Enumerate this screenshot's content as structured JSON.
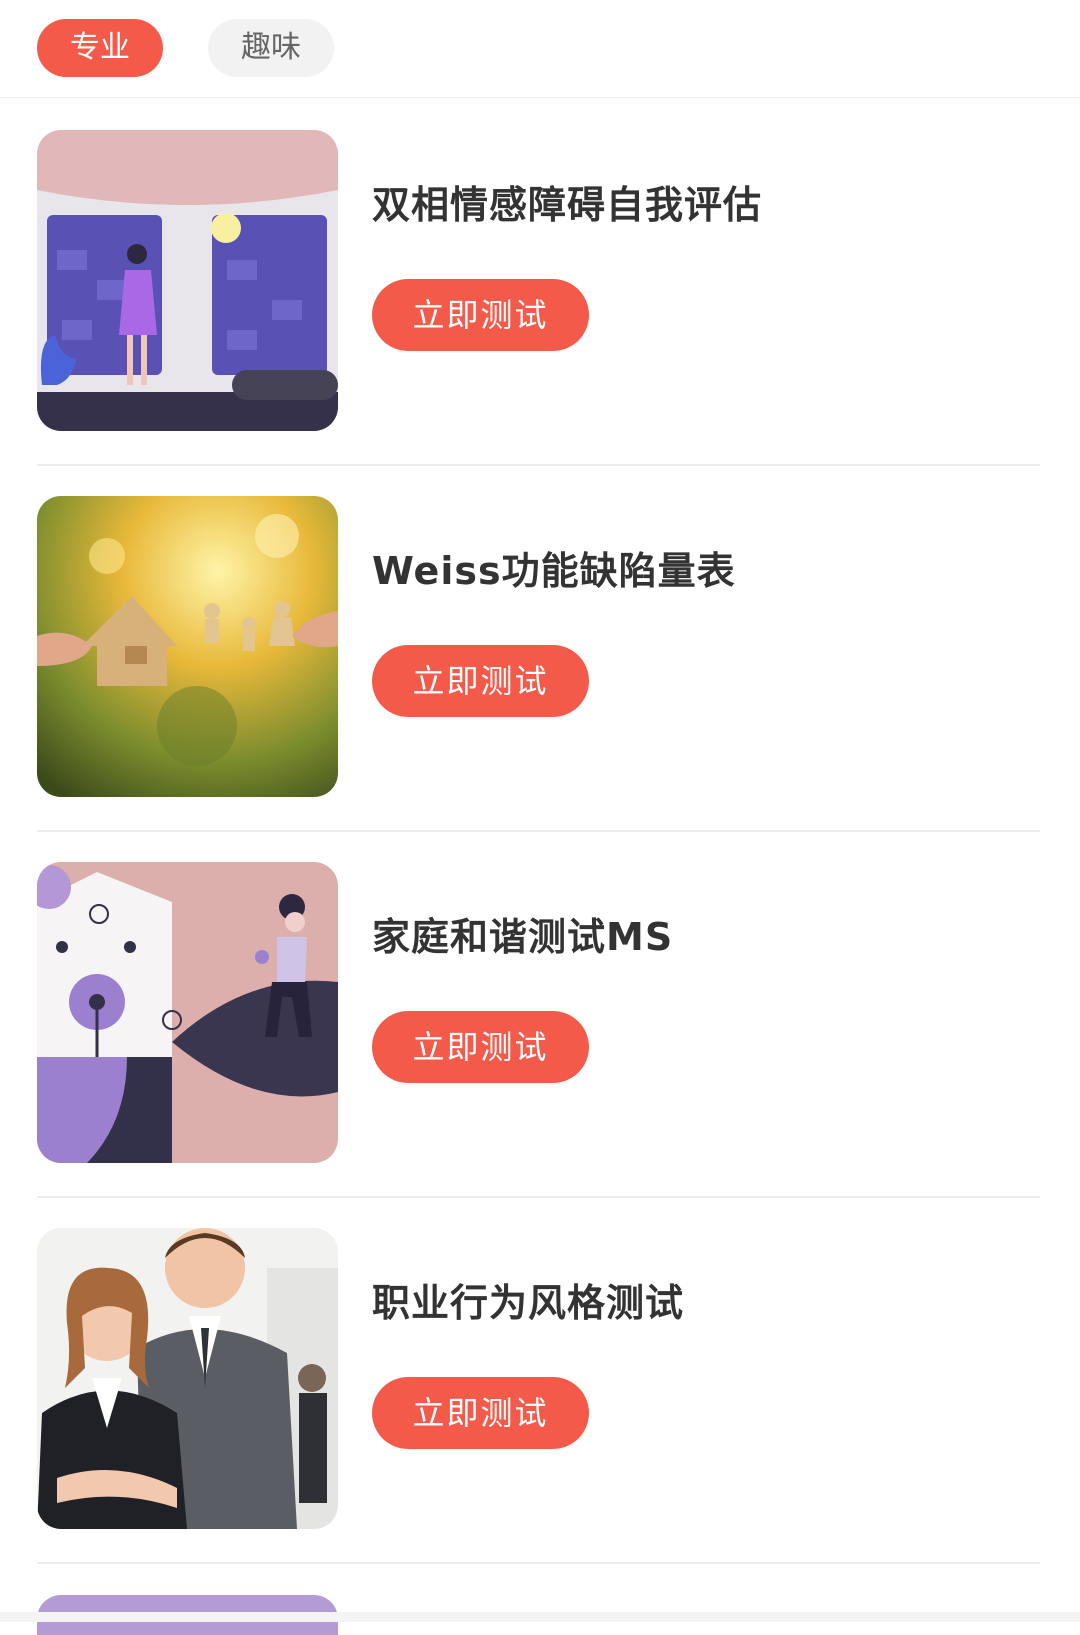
{
  "tabs": [
    {
      "label": "专业",
      "active": true
    },
    {
      "label": "趣味",
      "active": false
    }
  ],
  "tests": [
    {
      "title": "双相情感障碍自我评估",
      "button": "立即测试",
      "image": "woman-at-window-illustration"
    },
    {
      "title": "Weiss功能缺陷量表",
      "button": "立即测试",
      "image": "paper-house-family-photo"
    },
    {
      "title": "家庭和谐测试MS",
      "button": "立即测试",
      "image": "girl-sitting-with-flower-illustration"
    },
    {
      "title": "职业行为风格测试",
      "button": "立即测试",
      "image": "business-people-photo"
    }
  ],
  "colors": {
    "accent": "#f45a4a",
    "tab_inactive_bg": "#f2f2f2",
    "divider": "#eeeeee"
  }
}
